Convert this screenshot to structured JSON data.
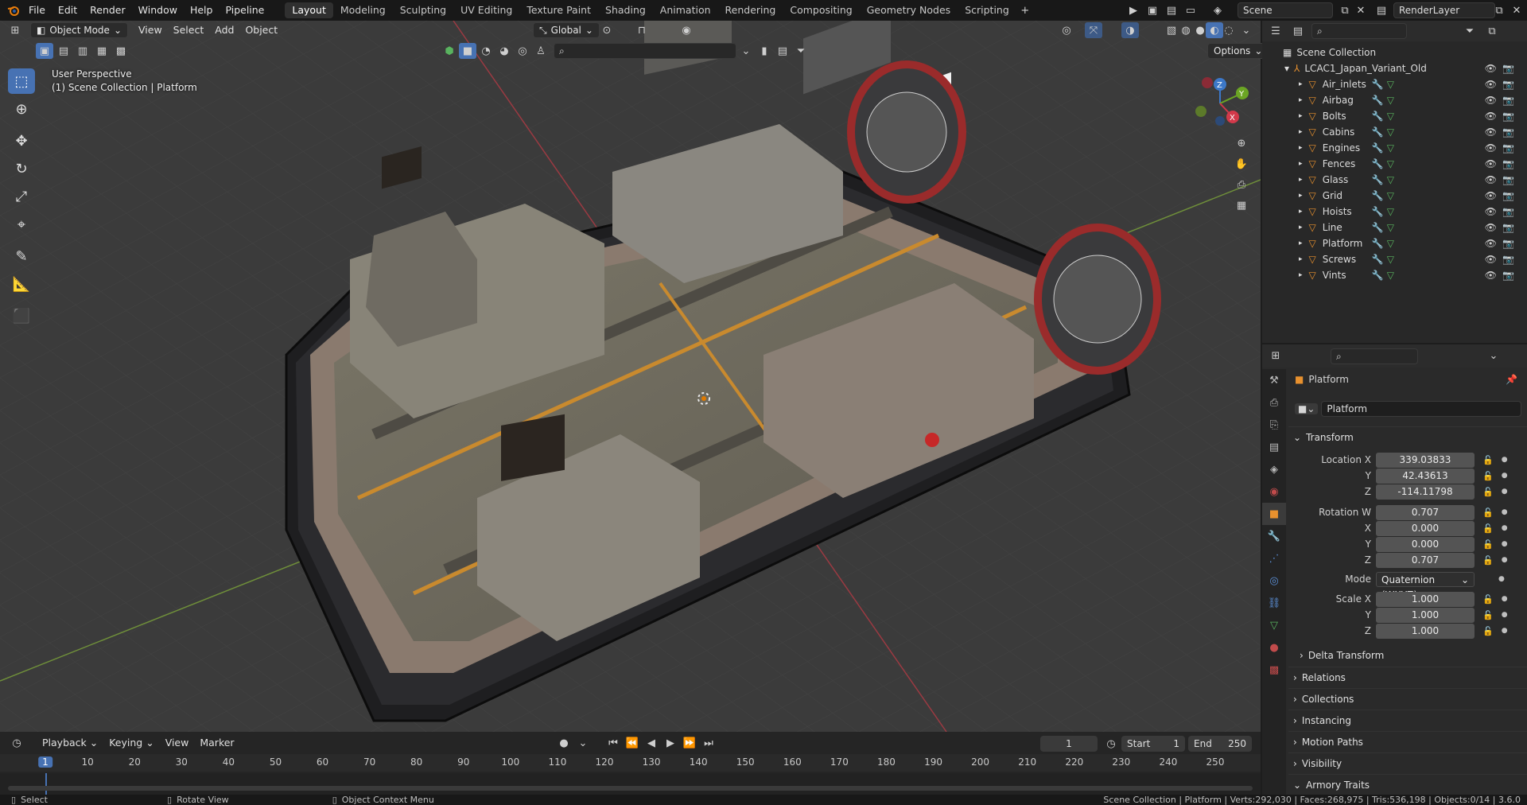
{
  "app": {
    "logo": "blender-logo-icon"
  },
  "menus": [
    "File",
    "Edit",
    "Render",
    "Window",
    "Help",
    "Pipeline"
  ],
  "workspaces": [
    "Layout",
    "Modeling",
    "Sculpting",
    "UV Editing",
    "Texture Paint",
    "Shading",
    "Animation",
    "Rendering",
    "Compositing",
    "Geometry Nodes",
    "Scripting"
  ],
  "active_workspace": "Layout",
  "scene": {
    "name": "Scene",
    "view_layer": "RenderLayer"
  },
  "viewport": {
    "mode": "Object Mode",
    "menus": [
      "View",
      "Select",
      "Add",
      "Object"
    ],
    "orientation": "Global",
    "options_label": "Options",
    "overlay_line1": "User Perspective",
    "overlay_line2": "(1) Scene Collection | Platform",
    "gizmo_axes": [
      "Z",
      "Y",
      "X"
    ],
    "accent": "#4772b3"
  },
  "outliner": {
    "root": "Scene Collection",
    "collection": "LCAC1_Japan_Variant_Old",
    "items": [
      "Air_inlets",
      "Airbag",
      "Bolts",
      "Cabins",
      "Engines",
      "Fences",
      "Glass",
      "Grid",
      "Hoists",
      "Line",
      "Platform",
      "Screws",
      "Vints"
    ]
  },
  "properties": {
    "object_name": "Platform",
    "data_name": "Platform",
    "transform_label": "Transform",
    "location": {
      "label": "Location X",
      "x": "339.03833",
      "y": "42.43613",
      "z": "-114.11798"
    },
    "rotation": {
      "label": "Rotation W",
      "w": "0.707",
      "x": "0.000",
      "y": "0.000",
      "z": "0.707"
    },
    "mode_label": "Mode",
    "mode_value": "Quaternion (WXYZ)",
    "scale": {
      "label": "Scale X",
      "x": "1.000",
      "y": "1.000",
      "z": "1.000"
    },
    "axis_labels": {
      "y": "Y",
      "z": "Z",
      "x": "X"
    },
    "sections": [
      "Delta Transform",
      "Relations",
      "Collections",
      "Instancing",
      "Motion Paths",
      "Visibility",
      "Armory Traits"
    ]
  },
  "timeline": {
    "menus": [
      "Playback",
      "Keying",
      "View",
      "Marker"
    ],
    "current_frame": "1",
    "start_label": "Start",
    "start": "1",
    "end_label": "End",
    "end": "250",
    "ticks": [
      "1",
      "10",
      "20",
      "30",
      "40",
      "50",
      "60",
      "70",
      "80",
      "90",
      "100",
      "110",
      "120",
      "130",
      "140",
      "150",
      "160",
      "170",
      "180",
      "190",
      "200",
      "210",
      "220",
      "230",
      "240",
      "250"
    ]
  },
  "status": {
    "left": [
      "Select",
      "Rotate View",
      "Object Context Menu"
    ],
    "right": "Scene Collection | Platform | Verts:292,030 | Faces:268,975 | Tris:536,198 | Objects:0/14 | 3.6.0"
  }
}
